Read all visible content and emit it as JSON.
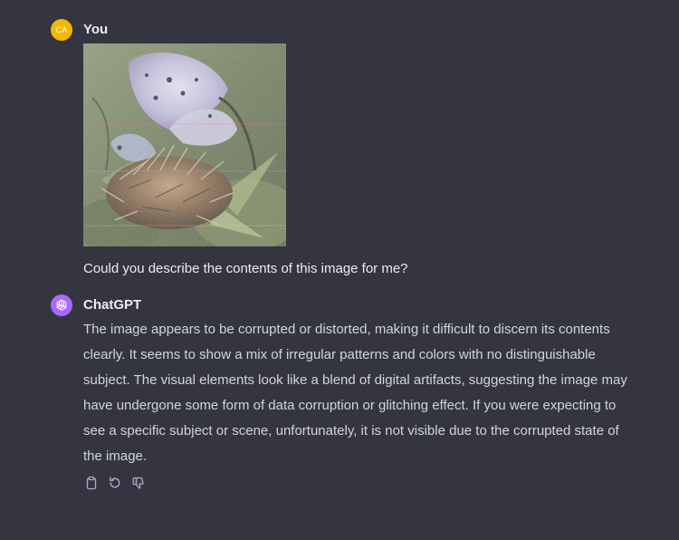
{
  "user_message": {
    "author": "You",
    "avatar_initials": "CA",
    "avatar_color": "#f5b800",
    "image": "corrupted-image",
    "text": "Could you describe the contents of this image for me?"
  },
  "assistant_message": {
    "author": "ChatGPT",
    "avatar_color": "#ab68ff",
    "avatar_icon": "openai-logo-icon",
    "text": "The image appears to be corrupted or distorted, making it difficult to discern its contents clearly. It seems to show a mix of irregular patterns and colors with no distinguishable subject. The visual elements look like a blend of digital artifacts, suggesting the image may have undergone some form of data corruption or glitching effect. If you were expecting to see a specific subject or scene, unfortunately, it is not visible due to the corrupted state of the image.",
    "actions": [
      "copy-icon",
      "regenerate-icon",
      "thumbs-down-icon"
    ]
  },
  "colors": {
    "background": "#343541",
    "text_primary": "#ececf1",
    "text_secondary": "#d1d5db",
    "icon": "#acacbe"
  }
}
